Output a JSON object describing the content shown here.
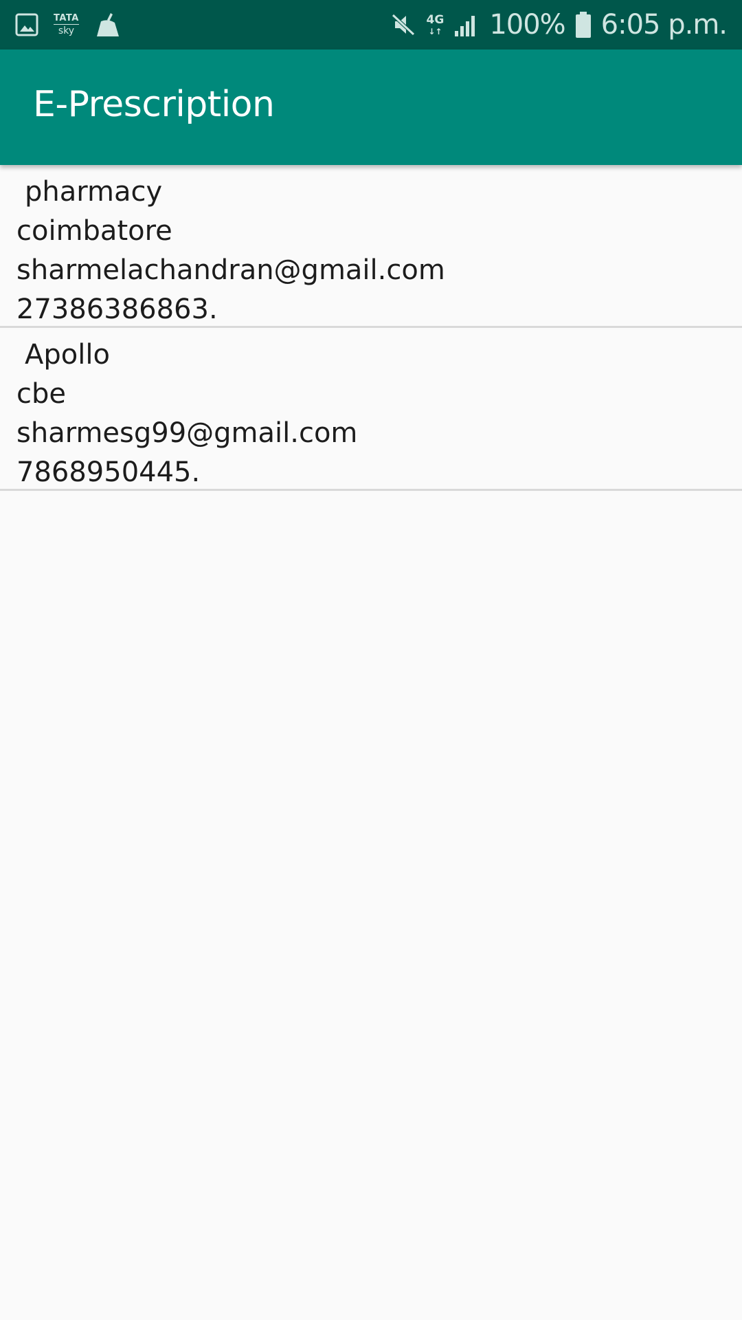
{
  "status_bar": {
    "carrier_line1": "TATA",
    "carrier_line2": "sky",
    "network_type": "4G",
    "network_arrows": "↓↑",
    "battery_percent": "100%",
    "time": "6:05 p.m.",
    "icons": [
      "gallery-icon",
      "tata-sky-icon",
      "cleaner-broom-icon",
      "mute-icon",
      "network-4g-icon",
      "signal-icon",
      "battery-icon"
    ],
    "color": "#00574b"
  },
  "app_bar": {
    "title": "E-Prescription",
    "color": "#00897b"
  },
  "pharmacies": [
    {
      "name": "pharmacy",
      "city": "coimbatore",
      "email": "sharmelachandran@gmail.com",
      "phone": "27386386863."
    },
    {
      "name": "Apollo",
      "city": "cbe",
      "email": "sharmesg99@gmail.com",
      "phone": "7868950445."
    }
  ]
}
